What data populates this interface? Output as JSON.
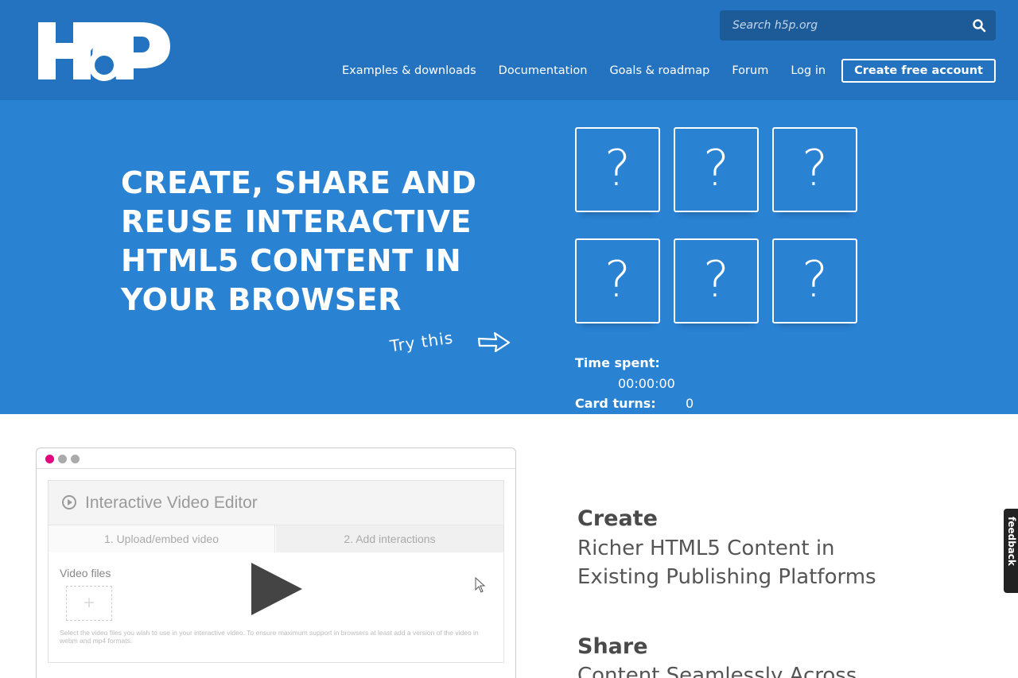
{
  "header": {
    "logo_text": "H5P",
    "search": {
      "placeholder": "Search h5p.org"
    },
    "nav": [
      {
        "label": "Examples & downloads"
      },
      {
        "label": "Documentation"
      },
      {
        "label": "Goals & roadmap"
      },
      {
        "label": "Forum"
      },
      {
        "label": "Log in"
      },
      {
        "label": "Create free account"
      }
    ],
    "colors": {
      "header_bg": "#2473c0",
      "search_bg": "#1c5a98"
    }
  },
  "hero": {
    "title": "CREATE, SHARE AND REUSE INTERACTIVE HTML5 CONTENT IN YOUR BROWSER",
    "try_this": "Try this",
    "cards": [
      "?",
      "?",
      "?",
      "?",
      "?",
      "?"
    ],
    "time_spent_label": "Time spent:",
    "time_spent_value": "00:00:00",
    "card_turns_label": "Card turns:",
    "card_turns_value": "0",
    "colors": {
      "hero_bg": "#2a82d3"
    }
  },
  "editor": {
    "title": "Interactive Video Editor",
    "tabs": [
      "1. Upload/embed video",
      "2. Add interactions"
    ],
    "video_files_label": "Video files",
    "upload_plus": "+",
    "help_text": "Select the video files you wish to use in your interactive video. To ensure maximum support in browsers at least add a version of the video in webm and mp4 formats.",
    "dot_colors": [
      "#e5007e",
      "#aaaaaa",
      "#aaaaaa"
    ]
  },
  "features": [
    {
      "title": "Create",
      "text": "Richer HTML5 Content in Existing Publishing Platforms"
    },
    {
      "title": "Share",
      "text": "Content Seamlessly Across"
    }
  ],
  "feedback_tab": "feedback"
}
